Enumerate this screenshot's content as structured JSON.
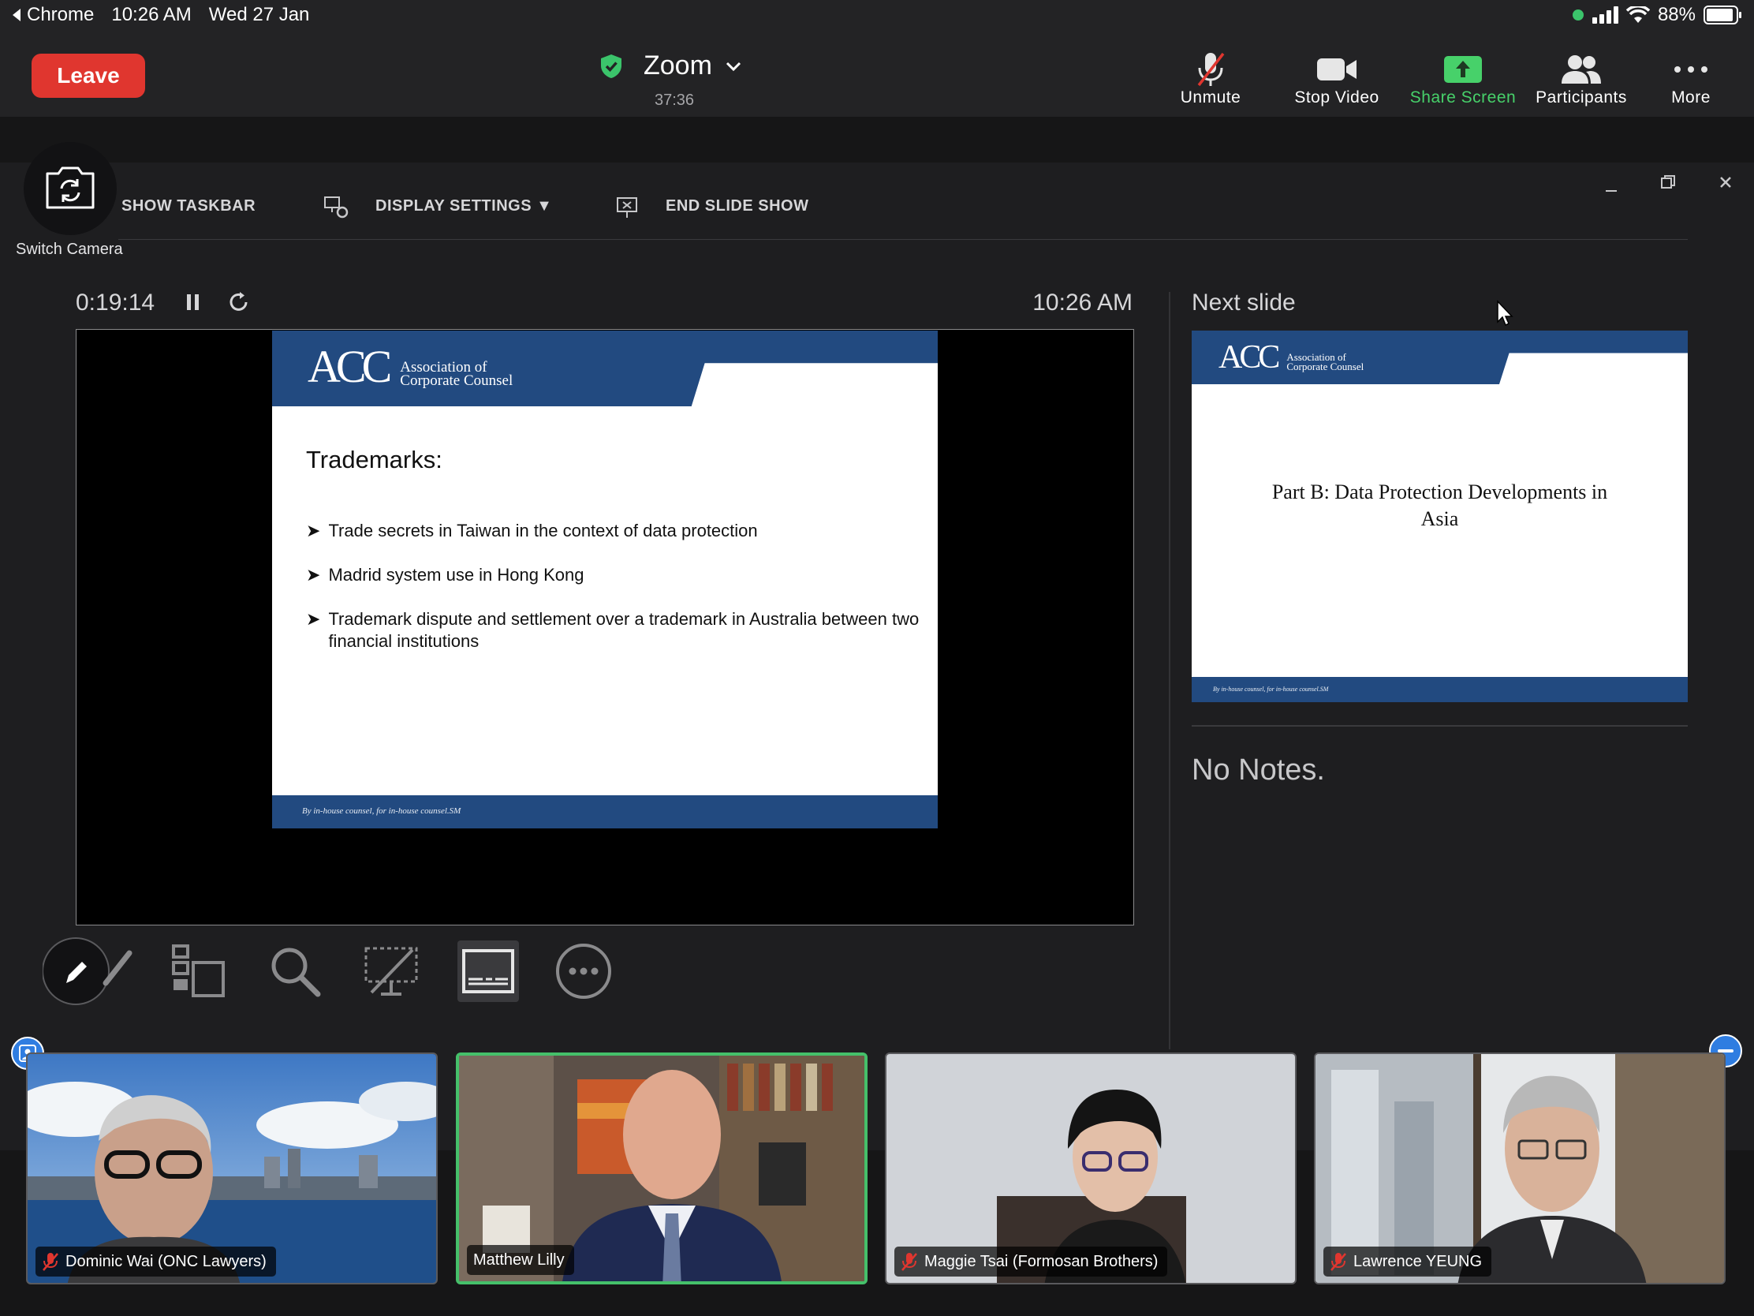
{
  "status_bar": {
    "back_app": "Chrome",
    "time": "10:26 AM",
    "date": "Wed 27 Jan",
    "battery": "88%"
  },
  "zoom": {
    "leave_label": "Leave",
    "title": "Zoom",
    "meeting_timer": "37:36",
    "toolbar": {
      "unmute": "Unmute",
      "stop_video": "Stop Video",
      "share_screen": "Share Screen",
      "participants": "Participants",
      "more": "More"
    },
    "colors": {
      "leave": "#e0362f",
      "share": "#47d16a",
      "secure": "#3bc46b",
      "active_speaker": "#45c06a"
    }
  },
  "switch_camera": {
    "label": "Switch Camera"
  },
  "presenter": {
    "show_taskbar": "SHOW TASKBAR",
    "display_settings": "DISPLAY SETTINGS ▼",
    "end_slide_show": "END SLIDE SHOW",
    "elapsed": "0:19:14",
    "clock": "10:26 AM",
    "next_slide_label": "Next slide",
    "no_notes": "No Notes.",
    "current_slide": {
      "logo_mark": "ACC",
      "logo_line1": "Association of",
      "logo_line2": "Corporate Counsel",
      "title": "Trademarks:",
      "bullets": [
        "Trade secrets in Taiwan in the context of data protection",
        "Madrid system use in Hong Kong",
        "Trademark dispute and settlement over a trademark in Australia between two financial institutions"
      ],
      "footer": "By in-house counsel, for in-house counsel.SM"
    },
    "next_slide": {
      "logo_mark": "ACC",
      "logo_line1": "Association of",
      "logo_line2": "Corporate Counsel",
      "title": "Part B: Data Protection Developments in Asia",
      "footer": "By in-house counsel, for in-house counsel.SM"
    }
  },
  "participants": [
    {
      "name": "Dominic Wai (ONC Lawyers)",
      "muted": true
    },
    {
      "name": "Matthew Lilly",
      "muted": false
    },
    {
      "name": "Maggie Tsai (Formosan Brothers)",
      "muted": true
    },
    {
      "name": "Lawrence YEUNG",
      "muted": true
    }
  ]
}
